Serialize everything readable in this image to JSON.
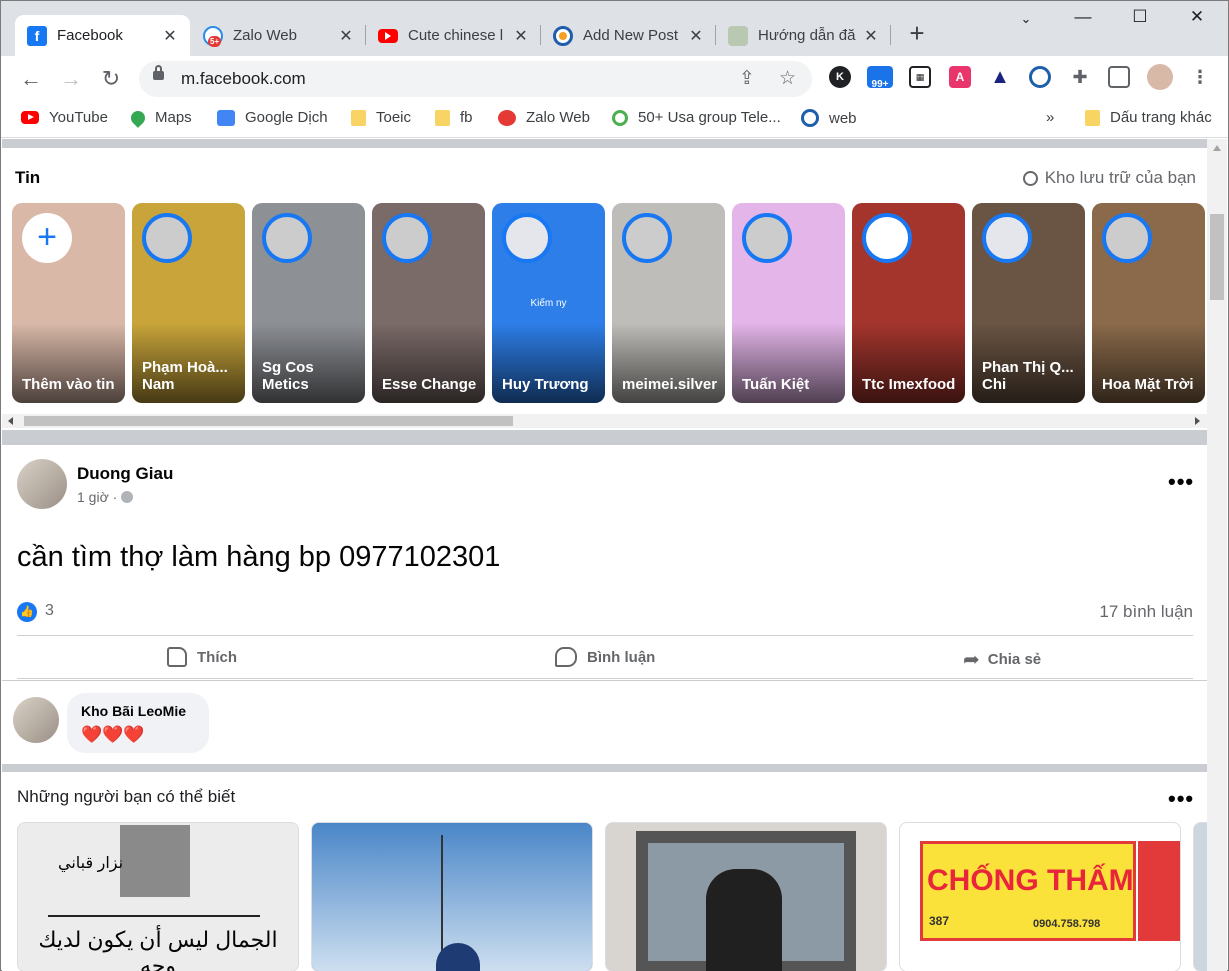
{
  "tabs": [
    {
      "title": "Facebook",
      "icon": "facebook-icon",
      "active": true
    },
    {
      "title": "Zalo Web",
      "icon": "zalo-icon"
    },
    {
      "title": "Cute chinese l",
      "icon": "youtube-icon"
    },
    {
      "title": "Add New Post",
      "icon": "wordpress-icon"
    },
    {
      "title": "Hướng dẫn đă",
      "icon": "guide-icon"
    }
  ],
  "toolbar": {
    "url": "m.facebook.com"
  },
  "extensions": {
    "badge": "99+"
  },
  "bookmarks": [
    {
      "label": "YouTube",
      "icon": "youtube-icon"
    },
    {
      "label": "Maps",
      "icon": "maps-icon"
    },
    {
      "label": "Google Dịch",
      "icon": "translate-icon"
    },
    {
      "label": "Toeic",
      "icon": "folder-icon"
    },
    {
      "label": "fb",
      "icon": "folder-icon"
    },
    {
      "label": "Zalo Web",
      "icon": "zalo-icon"
    },
    {
      "label": "50+ Usa group Tele...",
      "icon": "group-icon"
    },
    {
      "label": "web",
      "icon": "web-icon"
    }
  ],
  "bookmarks_more": "»",
  "bookmarks_other": "Dấu trang khác",
  "stories": {
    "title": "Tin",
    "archive": "Kho lưu trữ của bạn",
    "items": [
      {
        "name": "Thêm vào tin",
        "bg": "#d9b8a8",
        "create": true
      },
      {
        "name": "Phạm Hoà... Nam",
        "bg": "#c8a43a"
      },
      {
        "name": "Sg Cos Metics",
        "bg": "#8d9095"
      },
      {
        "name": "Esse Change",
        "bg": "#7a6a68"
      },
      {
        "name": "Huy Trương",
        "bg": "#2d7ee8",
        "inner_text": "Kiếm ny"
      },
      {
        "name": "meimei.silver",
        "bg": "#bfbdb9"
      },
      {
        "name": "Tuấn Kiệt",
        "bg": "#e3b5e8"
      },
      {
        "name": "Ttc Imexfood",
        "bg": "#a3352d"
      },
      {
        "name": "Phan Thị Q... Chi",
        "bg": "#6a5443"
      },
      {
        "name": "Hoa Mặt Trời",
        "bg": "#8a6a4a"
      }
    ]
  },
  "post": {
    "author": "Duong Giau",
    "time": "1 giờ · ",
    "text": "cần tìm thợ làm hàng bp 0977102301",
    "reaction_count": "3",
    "comment_count": "17 bình luận",
    "actions": {
      "like": "Thích",
      "comment": "Bình luận",
      "share": "Chia sẻ"
    },
    "top_comment": {
      "author": "Kho Bãi LeoMie",
      "text": "❤️❤️❤️"
    }
  },
  "pymk": {
    "title": "Những người bạn có thể biết",
    "cards": [
      {
        "bg": "#ececec",
        "caption": "الجمال ليس أن يكون لديك وجه",
        "name_text": "نزار قباني"
      },
      {
        "bg": "#3a73b8"
      },
      {
        "bg": "#d8d4d0"
      },
      {
        "bg": "#e23a3a",
        "sign": "CHỐNG THẤM",
        "phone": "0904.758.798",
        "number": "387"
      }
    ]
  }
}
